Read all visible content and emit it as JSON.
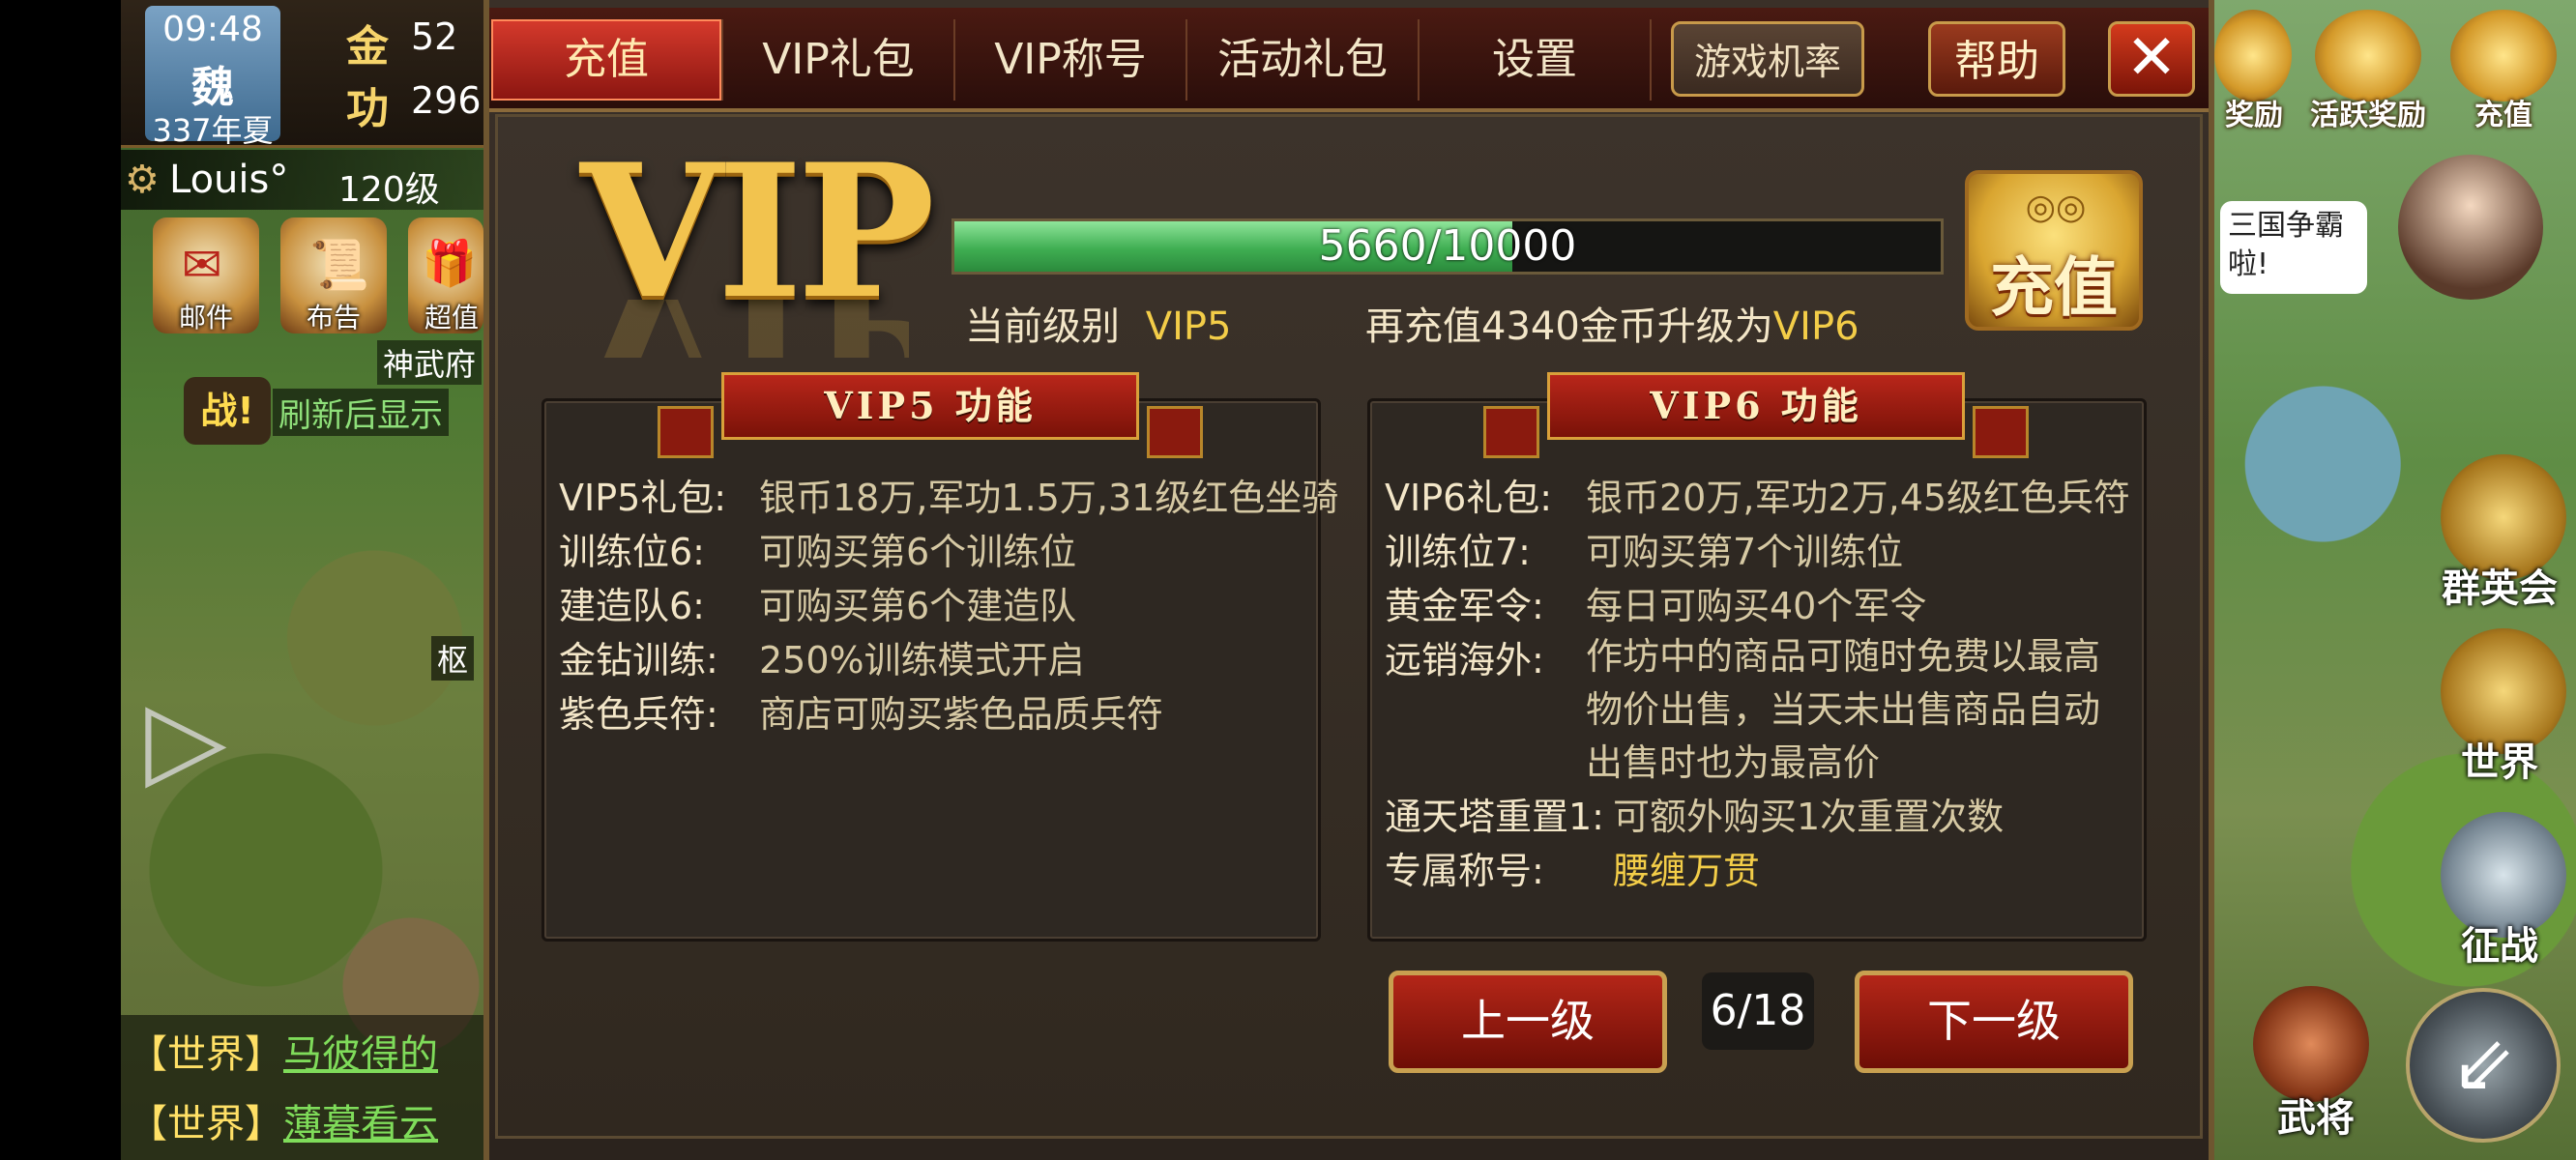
{
  "left_hud": {
    "time": "09:48",
    "kingdom": "魏",
    "season": "337年夏",
    "gold_label": "金",
    "gold_value": "52",
    "merit_label": "功",
    "merit_value": "296",
    "player_name": "Louis°",
    "player_level": "120级",
    "buttons": [
      {
        "label": "邮件",
        "icon": "mail-icon"
      },
      {
        "label": "布告",
        "icon": "scroll-icon"
      },
      {
        "label": "超值",
        "icon": "gift-icon"
      }
    ],
    "city_label": "神武府",
    "war_badge": "战!",
    "refresh_hint": "刷新后显示",
    "building_label": "枢",
    "chat": [
      {
        "channel": "【世界】",
        "name": "马彼得的"
      },
      {
        "channel": "【世界】",
        "name": "薄暮看云"
      }
    ]
  },
  "right_hud": {
    "top_icons": [
      {
        "label": "奖励",
        "icon": "chest-icon"
      },
      {
        "label": "活跃奖励",
        "icon": "fan-icon"
      },
      {
        "label": "充值",
        "icon": "coins-icon"
      }
    ],
    "bubble_text": [
      "三国争霸",
      "啦!"
    ],
    "side_buttons": [
      {
        "label": "群英会",
        "icon": "heroes-icon"
      },
      {
        "label": "世界",
        "icon": "compass-icon"
      },
      {
        "label": "征战",
        "icon": "crossed-swords-icon"
      },
      {
        "label": "武将",
        "icon": "general-icon"
      }
    ]
  },
  "dialog": {
    "tabs": [
      {
        "label": "充值",
        "active": true
      },
      {
        "label": "VIP礼包",
        "active": false
      },
      {
        "label": "VIP称号",
        "active": false
      },
      {
        "label": "活动礼包",
        "active": false
      },
      {
        "label": "设置",
        "active": false
      }
    ],
    "odds_button": "游戏机率",
    "help_button": "帮助",
    "close_button": "✕",
    "vip_logo": "VIP",
    "progress": {
      "current": 5660,
      "target": 10000,
      "text": "5660/10000",
      "fraction": 0.566
    },
    "recharge_button": "充值",
    "current_level_label": "当前级别",
    "current_level": "VIP5",
    "upgrade_text": "再充值4340金币升级为",
    "next_level": "VIP6",
    "left_box": {
      "title": "VIP5 功能",
      "rows": [
        {
          "label": "VIP5礼包:",
          "value": "银币18万,军功1.5万,31级红色坐骑"
        },
        {
          "label": "训练位6:",
          "value": "可购买第6个训练位"
        },
        {
          "label": "建造队6:",
          "value": "可购买第6个建造队"
        },
        {
          "label": "金钻训练:",
          "value": "250%训练模式开启"
        },
        {
          "label": "紫色兵符:",
          "value": "商店可购买紫色品质兵符"
        }
      ]
    },
    "right_box": {
      "title": "VIP6 功能",
      "rows": [
        {
          "label": "VIP6礼包:",
          "value": "银币20万,军功2万,45级红色兵符"
        },
        {
          "label": "训练位7:",
          "value": "可购买第7个训练位"
        },
        {
          "label": "黄金军令:",
          "value": "每日可购买40个军令"
        },
        {
          "label": "远销海外:",
          "value": "作坊中的商品可随时免费以最高物价出售，当天未出售商品自动出售时也为最高价"
        },
        {
          "label": "通天塔重置1:",
          "value": "可额外购买1次重置次数"
        },
        {
          "label": "专属称号:",
          "value": "腰缠万贯"
        }
      ]
    },
    "prev_button": "上一级",
    "next_button": "下一级",
    "page_indicator": "6/18"
  }
}
